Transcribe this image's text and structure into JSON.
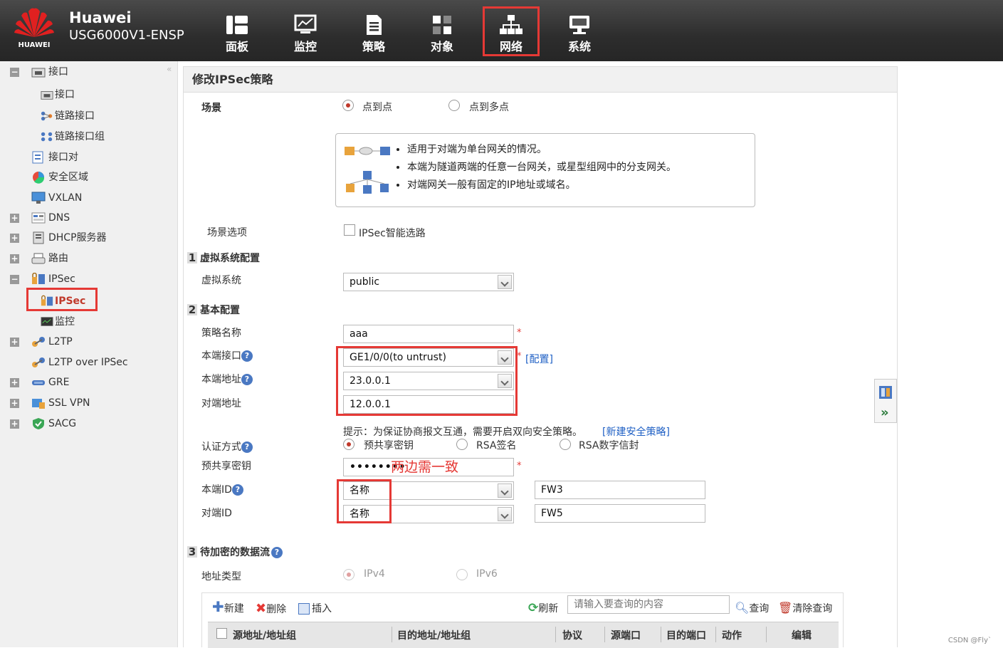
{
  "header": {
    "brand": "HUAWEI",
    "product_line1": "Huawei",
    "product_line2": "USG6000V1-ENSP",
    "nav": [
      {
        "label": "面板",
        "icon": "dashboard-icon"
      },
      {
        "label": "监控",
        "icon": "monitor-icon"
      },
      {
        "label": "策略",
        "icon": "policy-icon"
      },
      {
        "label": "对象",
        "icon": "object-icon"
      },
      {
        "label": "网络",
        "icon": "network-icon",
        "active": true
      },
      {
        "label": "系统",
        "icon": "system-icon"
      }
    ]
  },
  "sidebar": {
    "collapse": "«",
    "items": [
      {
        "label": "接口",
        "toggle": "−"
      },
      {
        "label": "接口"
      },
      {
        "label": "链路接口"
      },
      {
        "label": "链路接口组"
      },
      {
        "label": "接口对"
      },
      {
        "label": "安全区域"
      },
      {
        "label": "VXLAN"
      },
      {
        "label": "DNS",
        "toggle": "+"
      },
      {
        "label": "DHCP服务器",
        "toggle": "+"
      },
      {
        "label": "路由",
        "toggle": "+"
      },
      {
        "label": "IPSec",
        "toggle": "−"
      },
      {
        "label": "IPSec",
        "selected": true
      },
      {
        "label": "监控"
      },
      {
        "label": "L2TP",
        "toggle": "+"
      },
      {
        "label": "L2TP over IPSec"
      },
      {
        "label": "GRE",
        "toggle": "+"
      },
      {
        "label": "SSL VPN",
        "toggle": "+"
      },
      {
        "label": "SACG",
        "toggle": "+"
      }
    ]
  },
  "form": {
    "title": "修改IPSec策略",
    "scene_label": "场景",
    "scene_opt1": "点到点",
    "scene_opt2": "点到多点",
    "info": [
      "适用于对端为单台网关的情况。",
      "本端为隧道两端的任意一台网关，或星型组网中的分支网关。",
      "对端网关一般有固定的IP地址或域名。"
    ],
    "scene_option_label": "场景选项",
    "smart_route": "IPSec智能选路",
    "sec1_num": "1",
    "sec1": "虚拟系统配置",
    "vsys_label": "虚拟系统",
    "vsys_value": "public",
    "sec2_num": "2",
    "sec2": "基本配置",
    "policy_name_label": "策略名称",
    "policy_name": "aaa",
    "local_if_label": "本端接口",
    "local_if": "GE1/0/0(to untrust)",
    "config_link": "[配置]",
    "local_addr_label": "本端地址",
    "local_addr": "23.0.0.1",
    "peer_addr_label": "对端地址",
    "peer_addr": "12.0.0.1",
    "hint": "提示：为保证协商报文互通，需要开启双向安全策略。",
    "new_policy_link": "[新建安全策略]",
    "auth_label": "认证方式",
    "auth_opt1": "预共享密钥",
    "auth_opt2": "RSA签名",
    "auth_opt3": "RSA数字信封",
    "psk_label": "预共享密钥",
    "psk_value": "••••••••",
    "annotation": "两边需一致",
    "local_id_label": "本端ID",
    "local_id_type": "名称",
    "local_id_value": "FW3",
    "peer_id_label": "对端ID",
    "peer_id_type": "名称",
    "peer_id_value": "FW5",
    "sec3_num": "3",
    "sec3": "待加密的数据流",
    "addr_type_label": "地址类型",
    "addr_opt1": "IPv4",
    "addr_opt2": "IPv6",
    "help": "?",
    "star": "*"
  },
  "table": {
    "toolbar": {
      "new": "新建",
      "delete": "删除",
      "insert": "插入",
      "refresh": "刷新",
      "search_placeholder": "请输入要查询的内容",
      "query": "查询",
      "clear": "清除查询"
    },
    "columns": [
      "源地址/地址组",
      "目的地址/地址组",
      "协议",
      "源端口",
      "目的端口",
      "动作",
      "编辑"
    ]
  },
  "watermark": "CSDN @Fly`",
  "colors": {
    "accent_red": "#e53935",
    "link_blue": "#1e5fc4",
    "header_bg": "#2d2d2d"
  }
}
